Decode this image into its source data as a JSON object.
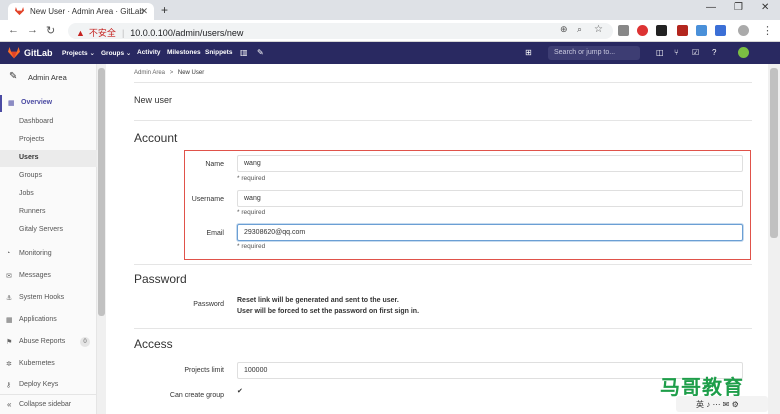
{
  "browser": {
    "tab_title": "New User · Admin Area · GitLab",
    "tab_close": "✕",
    "new_tab": "+",
    "url_warning": "不安全",
    "url": "10.0.0.100/admin/users/new",
    "win_min": "—",
    "win_max": "❐",
    "win_close": "✕"
  },
  "gitlab_header": {
    "brand": "GitLab",
    "nav": [
      "Projects ⌄",
      "Groups ⌄",
      "Activity",
      "Milestones",
      "Snippets"
    ],
    "search_placeholder": "Search or jump to..."
  },
  "sidebar": {
    "title": "Admin Area",
    "items": [
      {
        "label": "Overview",
        "icon": "grid-icon"
      },
      {
        "label": "Dashboard"
      },
      {
        "label": "Projects"
      },
      {
        "label": "Users"
      },
      {
        "label": "Groups"
      },
      {
        "label": "Jobs"
      },
      {
        "label": "Runners"
      },
      {
        "label": "Gitaly Servers"
      },
      {
        "label": "Monitoring"
      },
      {
        "label": "Messages"
      },
      {
        "label": "System Hooks"
      },
      {
        "label": "Applications"
      },
      {
        "label": "Abuse Reports",
        "count": "0"
      },
      {
        "label": "Kubernetes"
      },
      {
        "label": "Deploy Keys"
      }
    ],
    "collapse": "Collapse sidebar"
  },
  "breadcrumb": {
    "parent": "Admin Area",
    "separator": ">",
    "current": "New User"
  },
  "page_title": "New user",
  "account": {
    "title": "Account",
    "name_label": "Name",
    "name_value": "wang",
    "username_label": "Username",
    "username_value": "wang",
    "email_label": "Email",
    "email_value": "29308620@qq.com",
    "required": "* required"
  },
  "password": {
    "title": "Password",
    "label": "Password",
    "line1": "Reset link will be generated and sent to the user.",
    "line2": "User will be forced to set the password on first sign in."
  },
  "access": {
    "title": "Access",
    "projects_limit_label": "Projects limit",
    "projects_limit_value": "100000",
    "can_create_group_label": "Can create group",
    "can_create_group_checked": true
  },
  "watermark": {
    "brand": "马哥教育",
    "ime": "英 ♪ ⋯ ✉ ⚙"
  },
  "colors": {
    "gitlab_header": "#292961",
    "accent": "#4b4ba3",
    "highlight_box": "#e0524a"
  }
}
